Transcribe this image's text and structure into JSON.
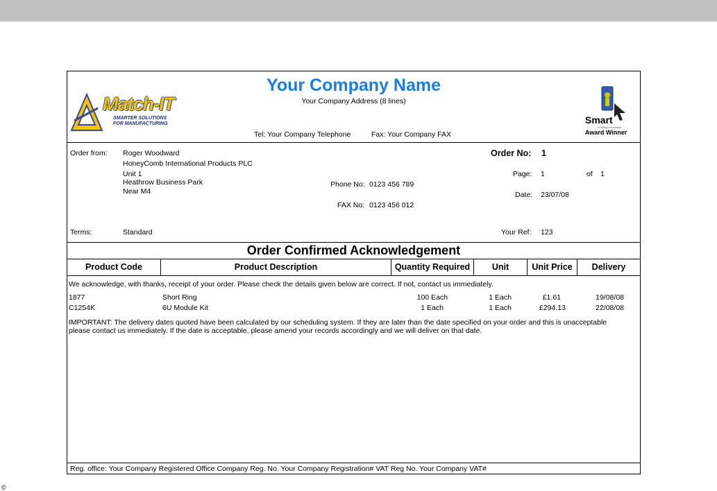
{
  "company": {
    "name": "Your Company Name",
    "address": "Your Company Address (8 lines)",
    "tel": "Tel: Your Company Telephone",
    "fax": "Fax: Your Company FAX"
  },
  "logo": {
    "name": "Match-IT",
    "tagline1": "SMARTER SOLUTIONS",
    "tagline2": "FOR MANUFACTURING",
    "colors": {
      "gold": "#f2c400",
      "navy": "#203080"
    }
  },
  "award": {
    "smart": "Smart",
    "fine": "Funding Innovation",
    "winner": "Award Winner"
  },
  "order": {
    "from_label": "Order from:",
    "from_lines": [
      "Roger Woodward",
      "HoneyComb International Products PLC",
      "Unit 1",
      "Heathrow Business Park",
      "Near M4"
    ],
    "phone_label": "Phone No:",
    "phone": "0123 456 789",
    "fax_label": "FAX No:",
    "fax": "0123 456 012",
    "order_no_label": "Order No:",
    "order_no": "1",
    "page_label": "Page:",
    "page": "1",
    "of_label": "of",
    "of": "1",
    "date_label": "Date:",
    "date": "23/07/08",
    "terms_label": "Terms:",
    "terms": "Standard",
    "ref_label": "Your Ref:",
    "ref": "123"
  },
  "title": "Order Confirmed Acknowledgement",
  "columns": [
    "Product Code",
    "Product Description",
    "Quantity Required",
    "Unit",
    "Unit Price",
    "Delivery"
  ],
  "intro": "We acknowledge, with thanks, receipt of your order. Please check the details given below are correct. If not, contact us immediately.",
  "rows": [
    {
      "code": "1877",
      "desc": "Short Ring",
      "qty": "100 Each",
      "unit": "1 Each",
      "price": "£1.61",
      "delivery": "19/08/08"
    },
    {
      "code": "C1254K",
      "desc": "6U Module Kit",
      "qty": "1 Each",
      "unit": "1 Each",
      "price": "£294.13",
      "delivery": "22/08/08"
    }
  ],
  "important_1": "IMPORTANT: The delivery dates quoted have been calculated by our scheduling system. If they are later than the date specified on your order and this is unacceptable",
  "important_2": "please contact us immediately. If the date is acceptable, please amend your records accordingly and we will deliver on that date.",
  "footer": "Reg. office: Your Company Registered Office Company Reg. No. Your Company Registration# VAT Reg No. Your Company VAT#",
  "corner_symbol": "©"
}
